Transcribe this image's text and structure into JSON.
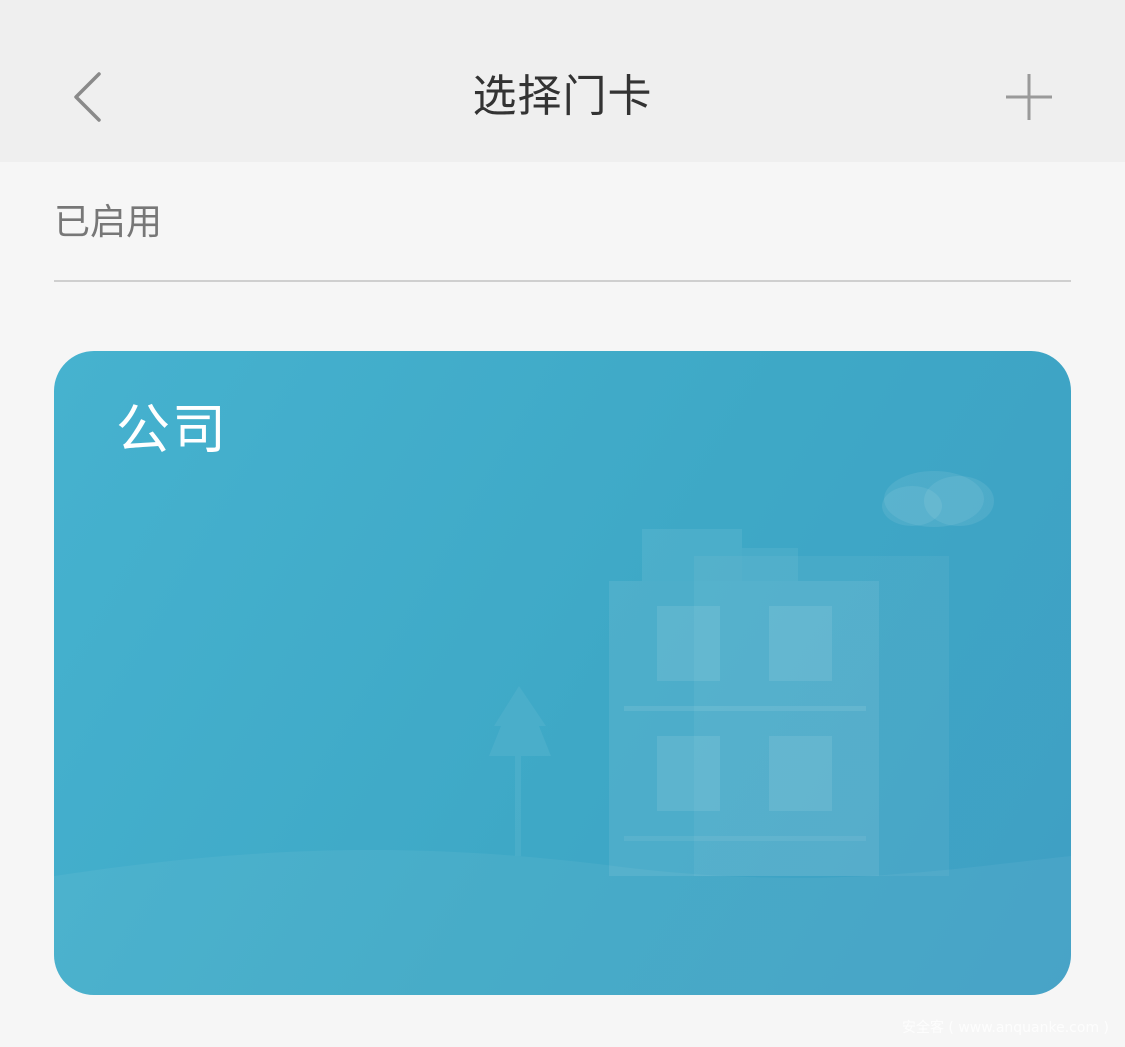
{
  "header": {
    "title": "选择门卡",
    "back_icon": "chevron-left-icon",
    "add_icon": "plus-icon"
  },
  "section": {
    "label": "已启用"
  },
  "cards": [
    {
      "name": "公司",
      "illustration": "building-icon"
    }
  ],
  "watermark": "安全客 ( www.anquanke.com )",
  "colors": {
    "header_bg": "#efefef",
    "page_bg": "#f6f6f6",
    "card_bg": "#42abc9",
    "title_text": "#333333",
    "label_text": "#777777",
    "icon_gray": "#8a8a8a"
  }
}
